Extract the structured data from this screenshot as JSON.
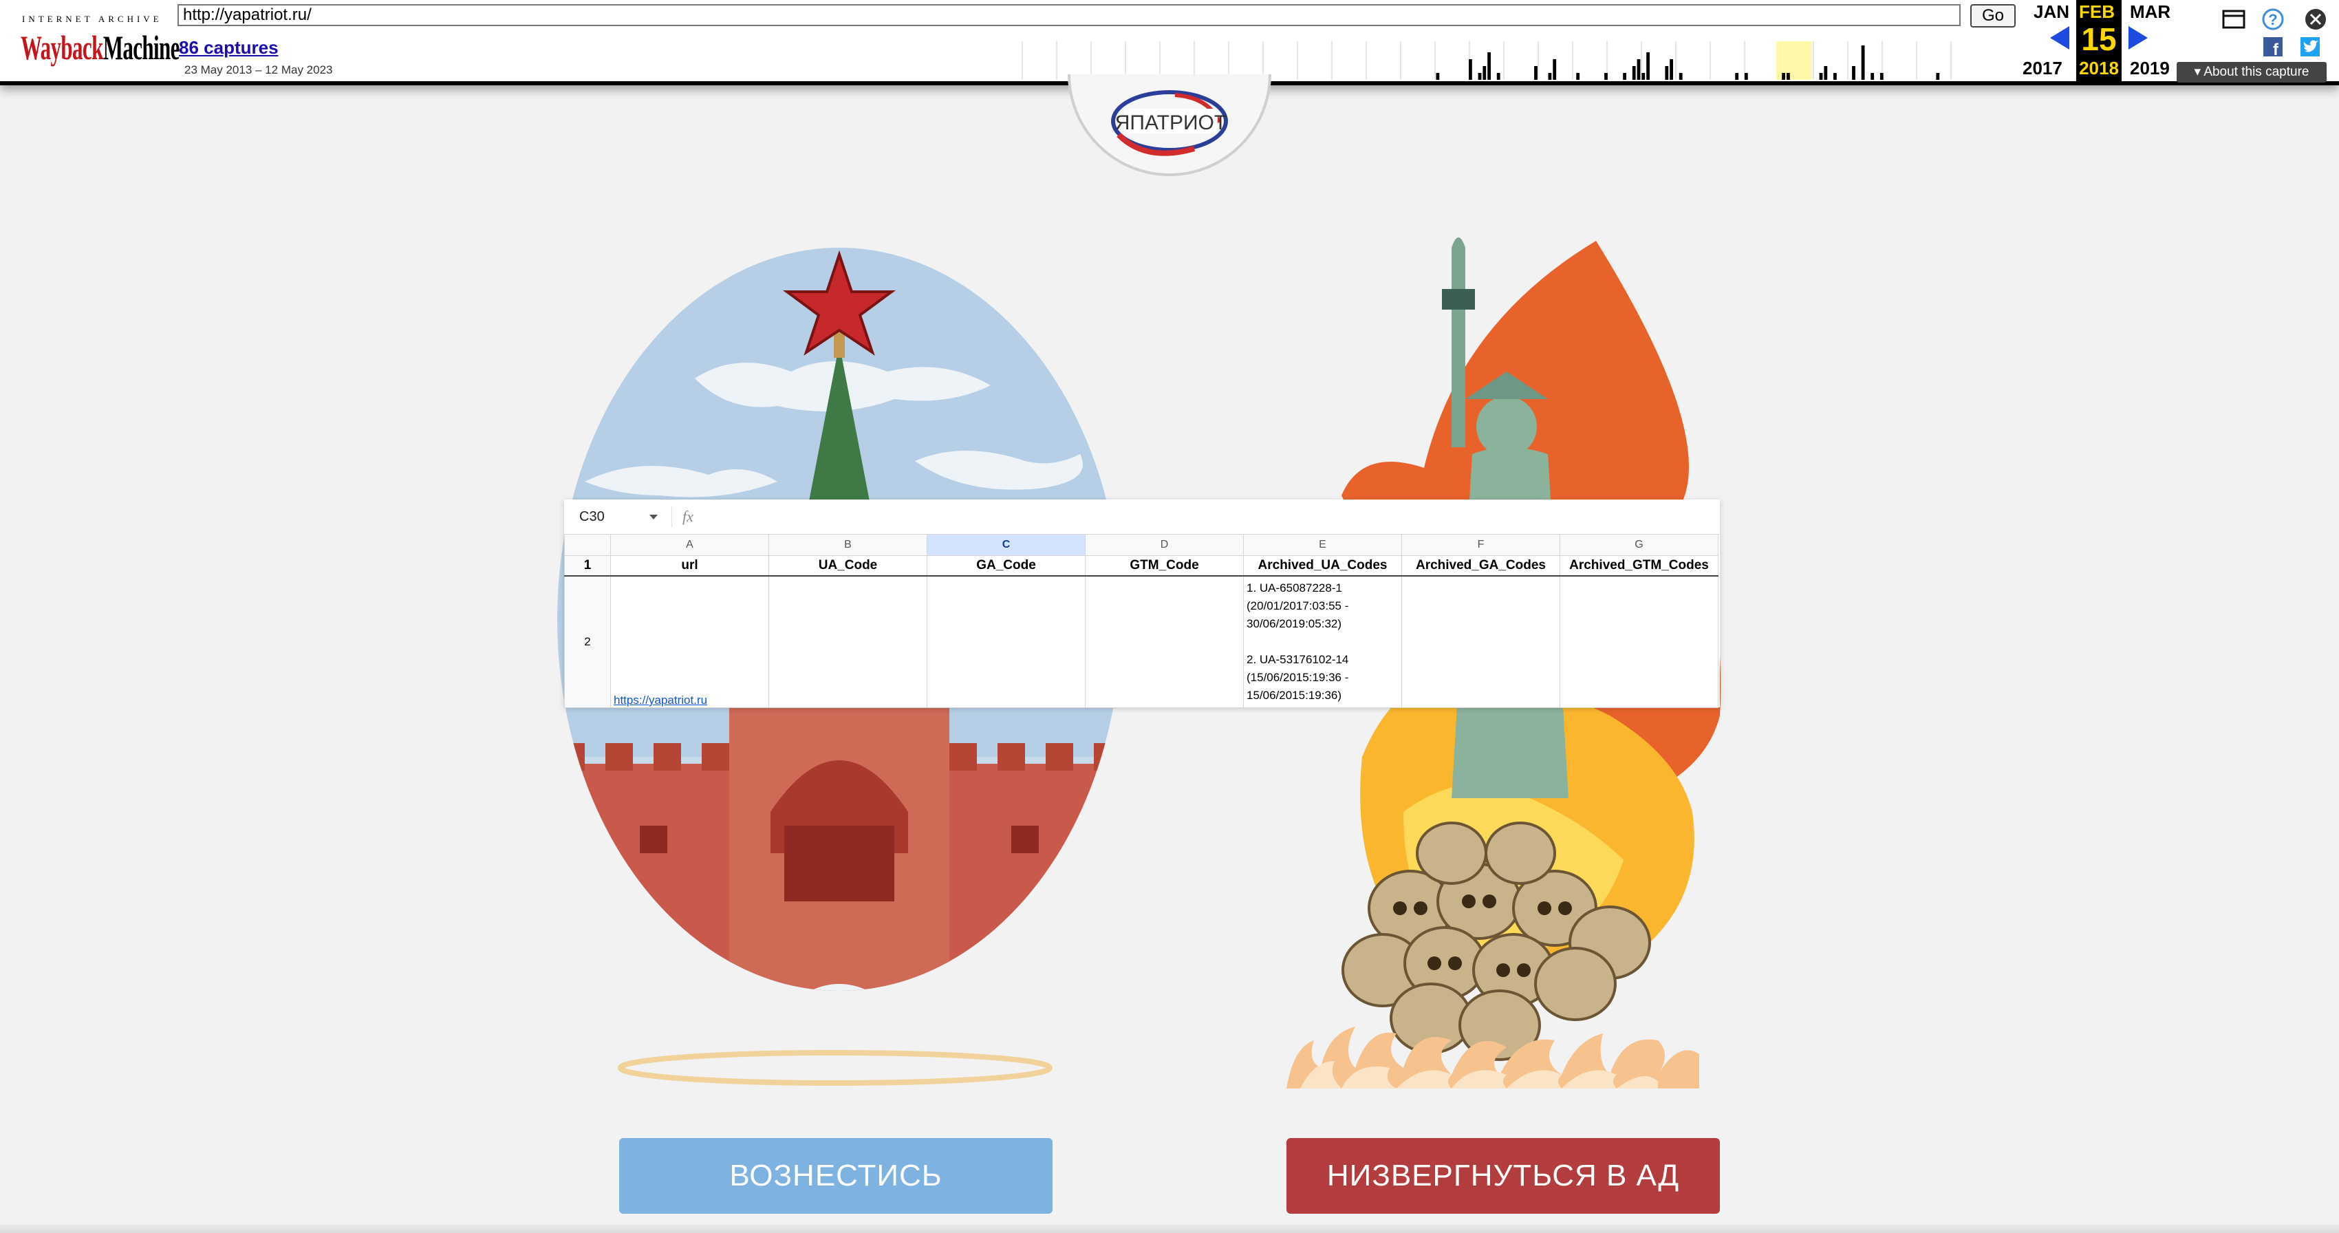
{
  "wayback": {
    "logo_top": "INTERNET ARCHIVE",
    "logo_way": "Wayback",
    "logo_machine": "Machine",
    "url": "http://yapatriot.ru/",
    "go_label": "Go",
    "captures_label": "86 captures",
    "date_range": "23 May 2013 – 12 May 2023",
    "calendar": {
      "prev_month": "JAN",
      "current_month": "FEB",
      "next_month": "MAR",
      "day": "15",
      "prev_year": "2017",
      "current_year": "2018",
      "next_year": "2019"
    },
    "about_label": "About this capture",
    "sparkline": [
      0,
      0,
      0,
      0,
      0,
      0,
      0,
      0,
      0,
      0,
      0,
      0,
      0,
      0,
      0,
      0,
      0,
      0,
      0,
      0,
      0,
      0,
      0,
      0,
      0,
      0,
      0,
      0,
      0,
      0,
      0,
      0,
      0,
      0,
      0,
      0,
      0,
      0,
      0,
      0,
      0,
      0,
      0,
      0,
      0,
      0,
      0,
      0,
      0,
      0,
      0,
      0,
      0,
      0,
      0,
      0,
      0,
      0,
      0,
      0,
      0,
      0,
      0,
      0,
      0,
      0,
      0,
      0,
      0,
      0,
      0,
      0,
      0,
      0,
      0,
      0,
      0,
      0,
      0,
      0,
      0,
      0,
      0,
      0,
      0,
      0,
      0,
      0,
      0,
      0,
      1,
      0,
      0,
      0,
      0,
      0,
      0,
      3,
      0,
      1,
      2,
      4,
      0,
      1,
      0,
      0,
      0,
      0,
      0,
      0,
      0,
      2,
      0,
      0,
      1,
      3,
      0,
      0,
      0,
      0,
      1,
      0,
      0,
      0,
      0,
      0,
      1,
      0,
      0,
      0,
      1,
      0,
      2,
      3,
      1,
      4,
      0,
      0,
      0,
      2,
      3,
      0,
      1,
      0,
      0,
      0,
      0,
      0,
      0,
      0,
      0,
      0,
      0,
      0,
      1,
      0,
      1,
      0,
      0,
      0,
      0,
      0,
      0,
      0,
      1,
      1,
      0,
      0,
      0,
      0,
      0,
      0,
      1,
      2,
      0,
      1,
      0,
      0,
      0,
      2,
      0,
      5,
      0,
      1,
      0,
      1,
      0,
      0,
      0,
      0,
      0,
      0,
      0,
      0,
      0,
      0,
      0,
      1,
      0,
      0,
      0,
      0,
      0,
      0
    ]
  },
  "site": {
    "logo_text": "ЯПАТРИОТ",
    "button_left": "ВОЗНЕСТИСЬ",
    "button_right": "НИЗВЕРГНУТЬСЯ В АД"
  },
  "sheet": {
    "namebox": "C30",
    "fx": "fx",
    "columns": [
      "A",
      "B",
      "C",
      "D",
      "E",
      "F",
      "G"
    ],
    "selected_column": "C",
    "rows": [
      "1",
      "2"
    ],
    "headers": [
      "url",
      "UA_Code",
      "GA_Code",
      "GTM_Code",
      "Archived_UA_Codes",
      "Archived_GA_Codes",
      "Archived_GTM_Codes"
    ],
    "url_value": "https://yapatriot.ru",
    "archived_ua": {
      "line1": "1. UA-65087228-1",
      "line2": "(20/01/2017:03:55 -",
      "line3": "30/06/2019:05:32)",
      "line4": "2. UA-53176102-14",
      "line5": "(15/06/2015:19:36 -",
      "line6": "15/06/2015:19:36)"
    }
  },
  "colors": {
    "wayback_red": "#c5151b",
    "calendar_highlight": "#ffd800",
    "button_blue": "#7eb2e1",
    "button_red": "#b33d3e",
    "link_blue": "#1a0dab"
  }
}
